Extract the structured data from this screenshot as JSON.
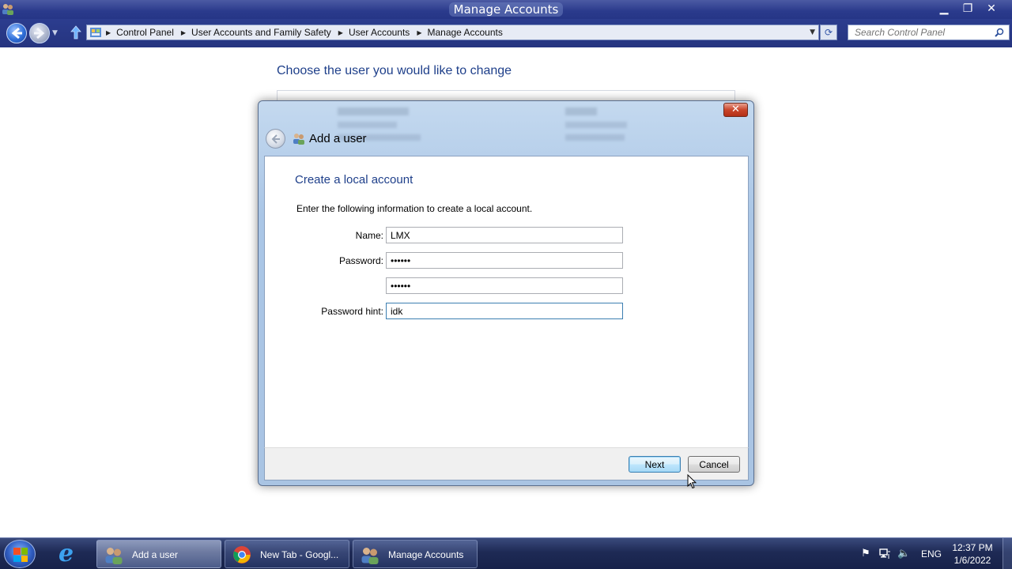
{
  "window": {
    "title": "Manage Accounts",
    "minimize": "▁",
    "restore": "❐",
    "close": "✕"
  },
  "nav": {
    "breadcrumbs": [
      "Control Panel",
      "User Accounts and Family Safety",
      "User Accounts",
      "Manage Accounts"
    ],
    "search_placeholder": "Search Control Panel"
  },
  "page": {
    "heading": "Choose the user you would like to change"
  },
  "dialog": {
    "title": "Add a user",
    "section_title": "Create a local account",
    "instructions": "Enter the following information to create a local account.",
    "fields": {
      "name": {
        "label": "Name:",
        "value": "LMX"
      },
      "password": {
        "label": "Password:",
        "value": "••••••"
      },
      "confirm_password": {
        "label": "",
        "value": "••••••"
      },
      "password_hint": {
        "label": "Password hint:",
        "value": "idk"
      }
    },
    "buttons": {
      "next": "Next",
      "cancel": "Cancel"
    }
  },
  "taskbar": {
    "tasks": [
      {
        "label": "Add a user",
        "active": true
      },
      {
        "label": "New Tab - Googl...",
        "active": false
      },
      {
        "label": "Manage Accounts",
        "active": false
      }
    ],
    "language": "ENG",
    "time": "12:37 PM",
    "date": "1/6/2022"
  },
  "colors": {
    "heading_blue": "#1e3f8a",
    "titlebar": "#2a3a8c",
    "taskbar": "#1e2a55"
  }
}
